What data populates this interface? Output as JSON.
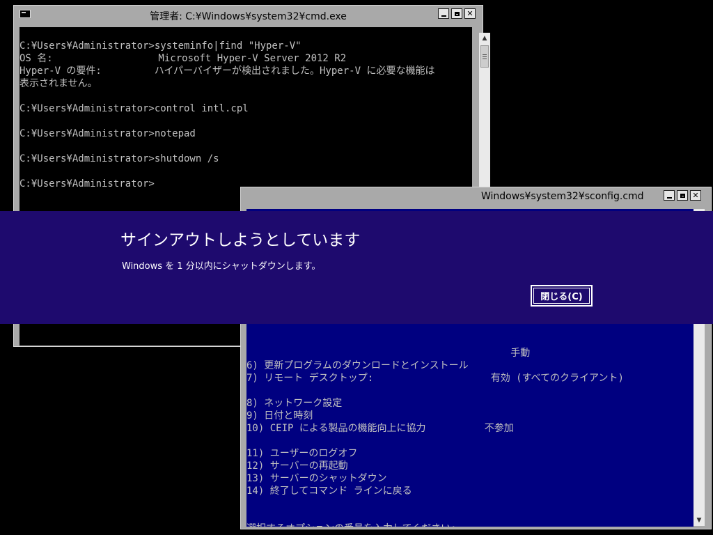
{
  "cmd_window": {
    "title": "管理者: C:¥Windows¥system32¥cmd.exe",
    "lines": [
      "",
      "C:¥Users¥Administrator>systeminfo|find \"Hyper-V\"",
      "OS 名:                  Microsoft Hyper-V Server 2012 R2",
      "Hyper-V の要件:         ハイパーバイザーが検出されました。Hyper-V に必要な機能は",
      "表示されません。",
      "",
      "C:¥Users¥Administrator>control intl.cpl",
      "",
      "C:¥Users¥Administrator>notepad",
      "",
      "C:¥Users¥Administrator>shutdown /s",
      "",
      "C:¥Users¥Administrator>"
    ]
  },
  "sconfig_window": {
    "title": "Windows¥system32¥sconfig.cmd",
    "lines": [
      "",
      "",
      "",
      "",
      "",
      "",
      "",
      "",
      "",
      "",
      "",
      "                                             手動",
      "6) 更新プログラムのダウンロードとインストール",
      "7) リモート デスクトップ:                    有効 (すべてのクライアント)",
      "",
      "8) ネットワーク設定",
      "9) 日付と時刻",
      "10) CEIP による製品の機能向上に協力          不参加",
      "",
      "11) ユーザーのログオフ",
      "12) サーバーの再起動",
      "13) サーバーのシャットダウン",
      "14) 終了してコマンド ラインに戻る",
      "",
      "",
      "選択するオプションの番号を入力してください:"
    ]
  },
  "signout_dialog": {
    "heading": "サインアウトしようとしています",
    "message": "Windows を 1 分以内にシャットダウンします。",
    "close_label": "閉じる(C)"
  },
  "window_controls": {
    "close_glyph": "✕"
  },
  "colors": {
    "desktop": "#000000",
    "signout_band": "#1e0a6e",
    "sconfig_bg": "#000080",
    "console_text": "#c0c0c0"
  }
}
